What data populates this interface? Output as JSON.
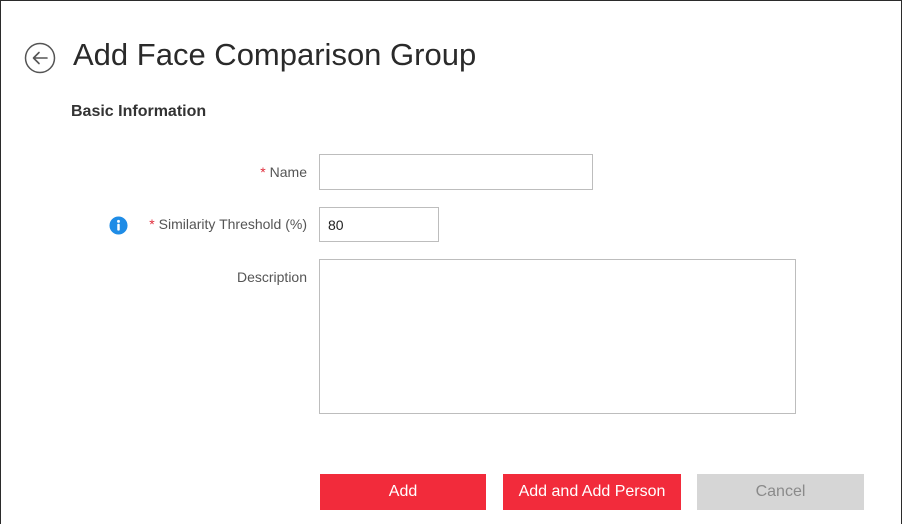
{
  "header": {
    "title": "Add Face Comparison Group",
    "back_icon": "back-arrow-circle-icon"
  },
  "section": {
    "title": "Basic Information"
  },
  "form": {
    "required_mark": "*",
    "name": {
      "label": "Name",
      "value": ""
    },
    "threshold": {
      "label": "Similarity Threshold (%)",
      "value": "80",
      "info_icon": "info-icon"
    },
    "description": {
      "label": "Description",
      "value": ""
    }
  },
  "buttons": {
    "add": "Add",
    "add_and_add_person": "Add and Add Person",
    "cancel": "Cancel"
  },
  "colors": {
    "primary": "#f22b3b",
    "required": "#e02d3c",
    "info": "#1f8ce6",
    "disabled": "#d6d6d6"
  }
}
